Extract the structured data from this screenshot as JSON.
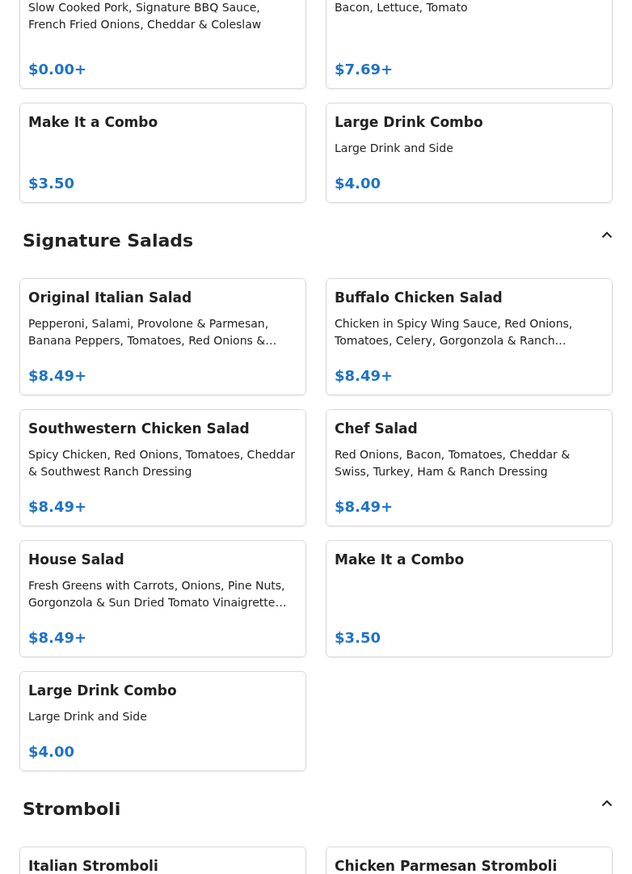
{
  "sections": [
    {
      "items": [
        {
          "description": "Slow Cooked Pork, Signature BBQ Sauce, French Fried Onions, Cheddar & Coleslaw",
          "price": "$0.00+"
        },
        {
          "description": "Bacon, Lettuce, Tomato",
          "price": "$7.69+"
        },
        {
          "title": "Make It a Combo",
          "price": "$3.50"
        },
        {
          "title": "Large Drink Combo",
          "description": "Large Drink and Side",
          "price": "$4.00"
        }
      ]
    },
    {
      "title": "Signature Salads",
      "expanded": true,
      "items": [
        {
          "title": "Original Italian Salad",
          "description": "Pepperoni, Salami, Provolone & Parmesan, Banana Peppers, Tomatoes, Red Onions &…",
          "price": "$8.49+"
        },
        {
          "title": "Buffalo Chicken Salad",
          "description": "Chicken in Spicy Wing Sauce, Red Onions, Tomatoes, Celery, Gorgonzola & Ranch…",
          "price": "$8.49+"
        },
        {
          "title": "Southwestern Chicken Salad",
          "description": "Spicy Chicken, Red Onions, Tomatoes, Cheddar & Southwest Ranch Dressing",
          "price": "$8.49+"
        },
        {
          "title": "Chef Salad",
          "description": "Red Onions, Bacon, Tomatoes, Cheddar & Swiss, Turkey, Ham & Ranch Dressing",
          "price": "$8.49+"
        },
        {
          "title": "House Salad",
          "description": "Fresh Greens with Carrots, Onions, Pine Nuts, Gorgonzola & Sun Dried Tomato Vinaigrette…",
          "price": "$8.49+"
        },
        {
          "title": "Make It a Combo",
          "price": "$3.50"
        },
        {
          "title": "Large Drink Combo",
          "description": "Large Drink and Side",
          "price": "$4.00"
        }
      ]
    },
    {
      "title": "Stromboli",
      "expanded": true,
      "items": [
        {
          "title": "Italian Stromboli"
        },
        {
          "title": "Chicken Parmesan Stromboli"
        }
      ]
    }
  ]
}
